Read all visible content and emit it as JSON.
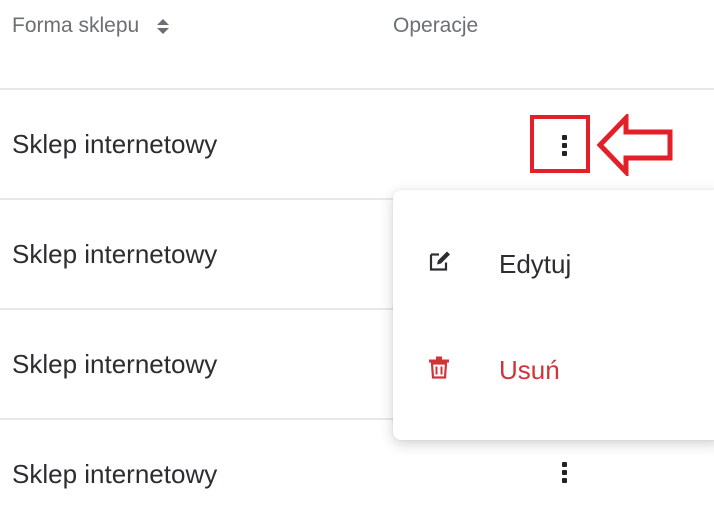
{
  "table": {
    "columns": {
      "form": "Forma sklepu",
      "operations": "Operacje"
    },
    "rows": [
      {
        "form": "Sklep internetowy"
      },
      {
        "form": "Sklep internetowy"
      },
      {
        "form": "Sklep internetowy"
      },
      {
        "form": "Sklep internetowy"
      }
    ]
  },
  "menu": {
    "edit_label": "Edytuj",
    "delete_label": "Usuń",
    "edit_icon": "edit-icon",
    "delete_icon": "trash-icon"
  },
  "colors": {
    "highlight": "#e3202a",
    "delete": "#d13438",
    "header_text": "#6c6f73"
  }
}
